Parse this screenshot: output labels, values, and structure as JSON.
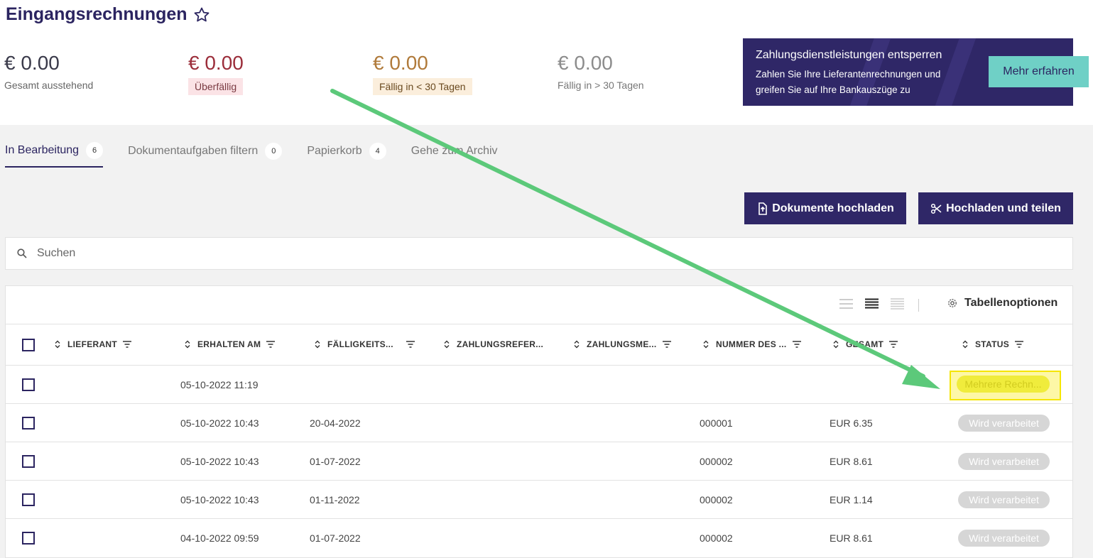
{
  "page": {
    "title": "Eingangsrechnungen"
  },
  "kpis": [
    {
      "amount": "€ 0.00",
      "label": "Gesamt ausstehend"
    },
    {
      "amount": "€ 0.00",
      "label": "Überfällig"
    },
    {
      "amount": "€ 0.00",
      "label": "Fällig in < 30 Tagen"
    },
    {
      "amount": "€ 0.00",
      "label": "Fällig in > 30 Tagen"
    }
  ],
  "promo": {
    "title": "Zahlungsdienstleistungen entsperren",
    "text": "Zahlen Sie Ihre Lieferantenrechnungen und greifen Sie auf Ihre Bankauszüge zu",
    "button": "Mehr erfahren"
  },
  "tabs": [
    {
      "label": "In Bearbeitung",
      "count": "6"
    },
    {
      "label": "Dokumentaufgaben filtern",
      "count": "0"
    },
    {
      "label": "Papierkorb",
      "count": "4"
    },
    {
      "label": "Gehe zum Archiv"
    }
  ],
  "actions": {
    "upload": "Dokumente hochladen",
    "split": "Hochladen und teilen"
  },
  "search": {
    "placeholder": "Suchen"
  },
  "table": {
    "options_label": "Tabellenoptionen",
    "columns": [
      "LIEFERANT",
      "ERHALTEN AM",
      "FÄLLIGKEITS...",
      "ZAHLUNGSREFER...",
      "ZAHLUNGSME...",
      "NUMMER DES ...",
      "GESAMT",
      "STATUS"
    ],
    "rows": [
      {
        "received": "05-10-2022 11:19",
        "due": "",
        "number": "",
        "total": "",
        "status": "Mehrere Rechn..."
      },
      {
        "received": "05-10-2022 10:43",
        "due": "20-04-2022",
        "number": "000001",
        "total": "EUR 6.35",
        "status": "Wird verarbeitet"
      },
      {
        "received": "05-10-2022 10:43",
        "due": "01-07-2022",
        "number": "000002",
        "total": "EUR 8.61",
        "status": "Wird verarbeitet"
      },
      {
        "received": "05-10-2022 10:43",
        "due": "01-11-2022",
        "number": "000002",
        "total": "EUR 1.14",
        "status": "Wird verarbeitet"
      },
      {
        "received": "04-10-2022 09:59",
        "due": "01-07-2022",
        "number": "000002",
        "total": "EUR 8.61",
        "status": "Wird verarbeitet"
      }
    ]
  },
  "colors": {
    "brand": "#2f2767",
    "accent": "#6fd0c6",
    "annotation_arrow": "#5cc97a",
    "highlight": "#f5e600"
  },
  "icons": [
    "star-icon",
    "search-icon",
    "upload-icon",
    "scissors-icon",
    "gear-icon",
    "sort-icon",
    "filter-icon",
    "density-icon"
  ]
}
